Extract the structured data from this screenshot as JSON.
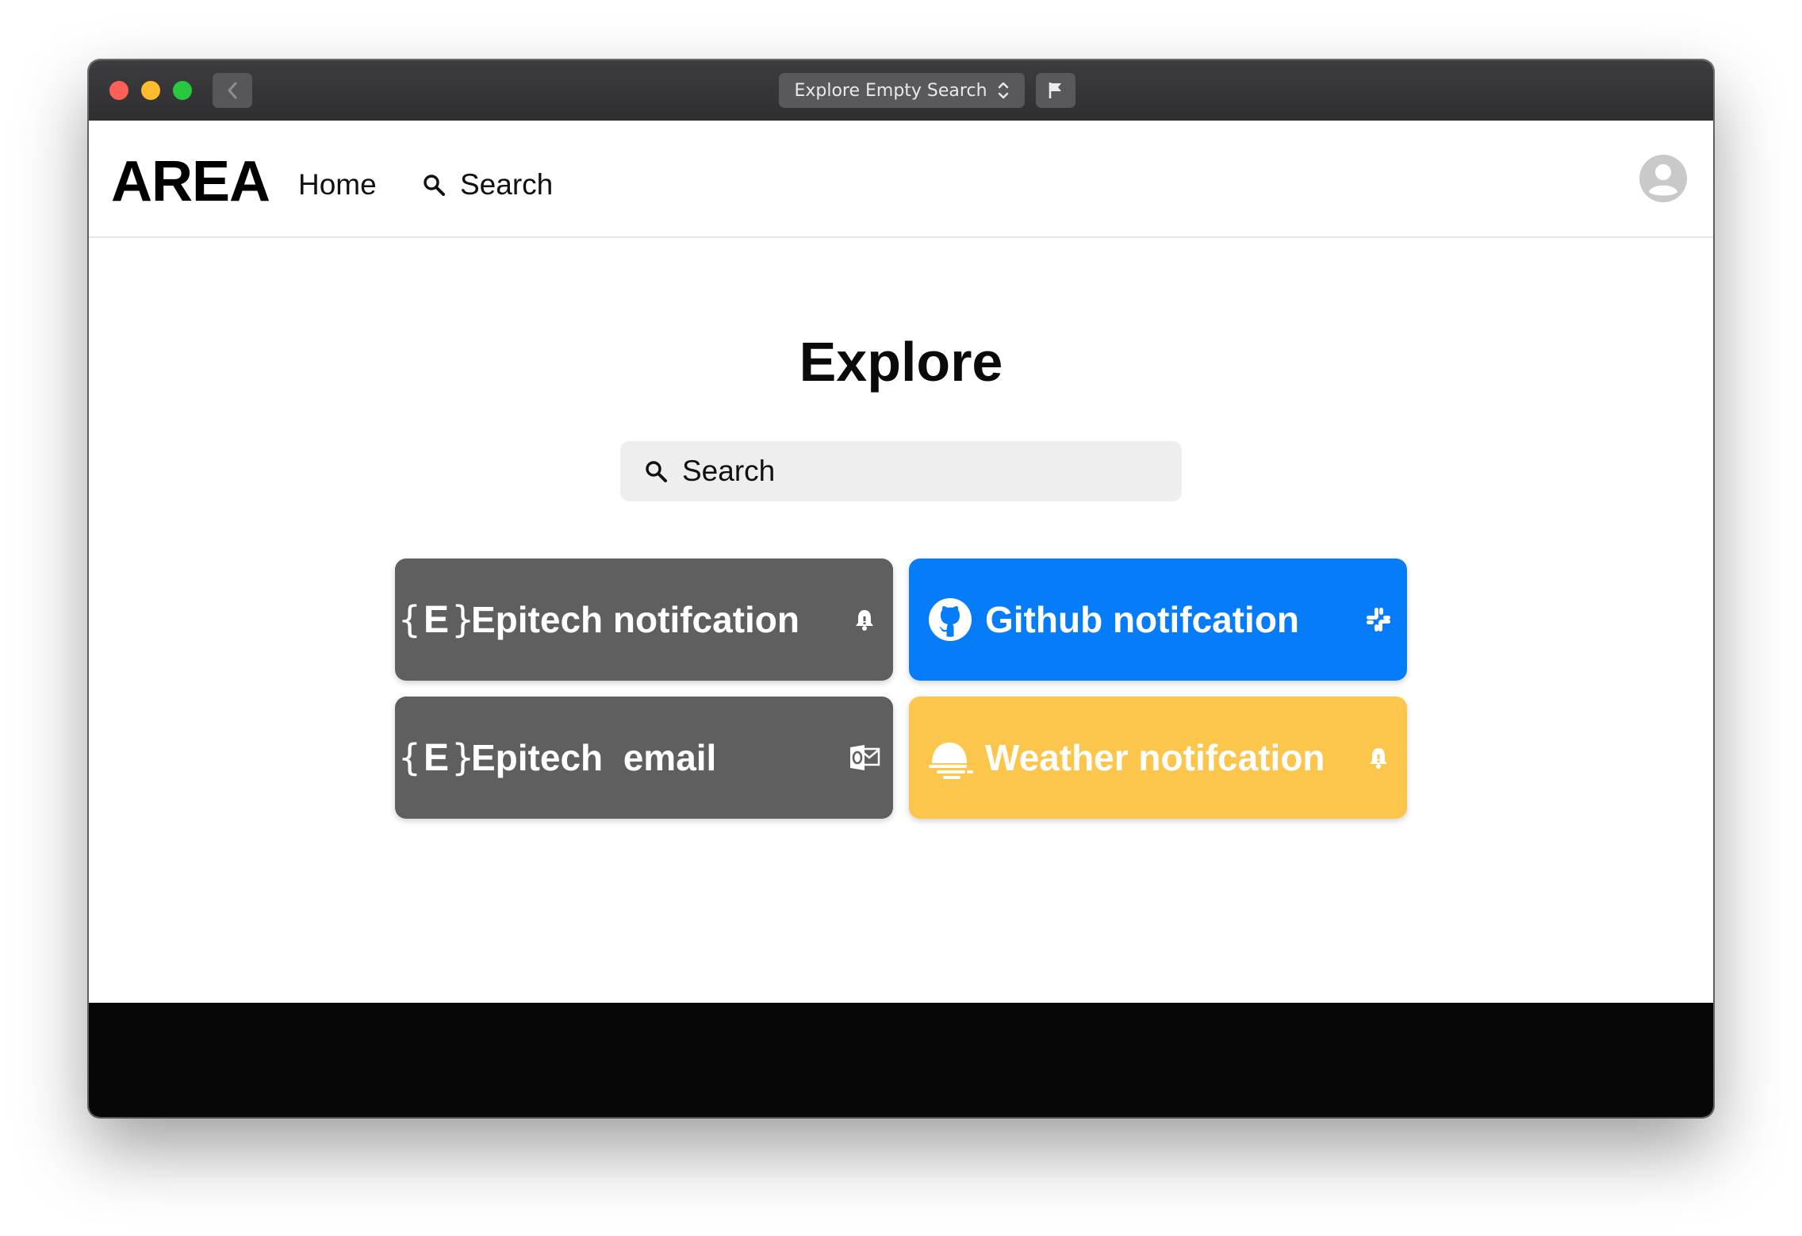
{
  "titlebar": {
    "tab_title": "Explore Empty Search"
  },
  "navbar": {
    "logo": "AREA",
    "home_label": "Home",
    "search_label": "Search"
  },
  "main": {
    "title": "Explore",
    "search_placeholder": "Search",
    "cards": [
      {
        "label": "Epitech notifcation",
        "brand_icon": "epitech-icon",
        "badge_icon": "bell-icon",
        "color": "#5f5f5f"
      },
      {
        "label": "Github notifcation",
        "brand_icon": "github-icon",
        "badge_icon": "slack-icon",
        "color": "#077cf9"
      },
      {
        "label": "Epitech  email",
        "brand_icon": "epitech-icon",
        "badge_icon": "outlook-icon",
        "color": "#5f5f5f"
      },
      {
        "label": "Weather notifcation",
        "brand_icon": "weather-icon",
        "badge_icon": "bell-icon",
        "color": "#fcc54c"
      }
    ]
  },
  "colors": {
    "titlebar": "#2f2f32",
    "footer": "#070707",
    "search_bg": "#eeeeee"
  }
}
